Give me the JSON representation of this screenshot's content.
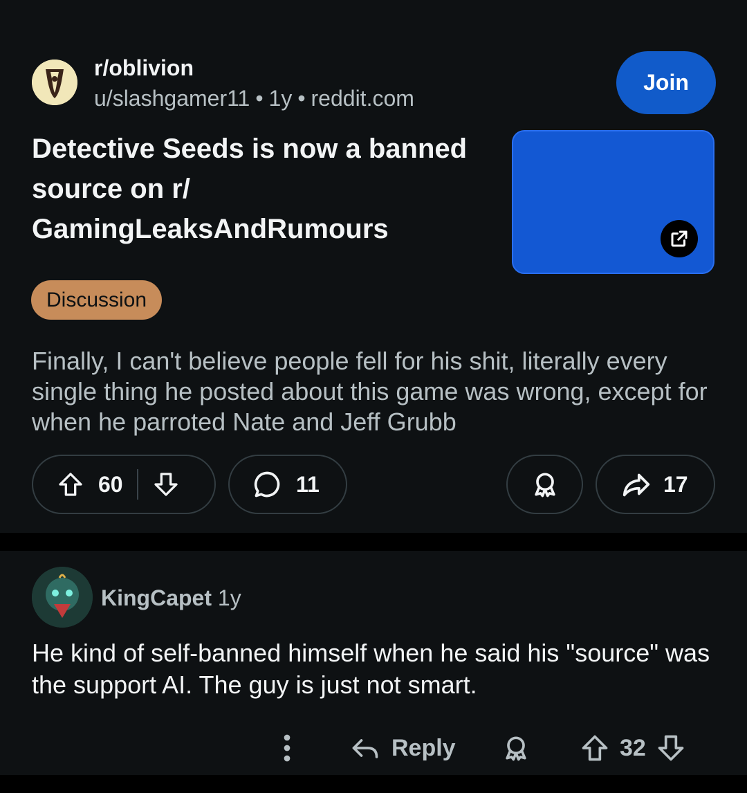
{
  "post": {
    "subreddit": "r/oblivion",
    "author": "u/slashgamer11",
    "age": "1y",
    "domain": "reddit.com",
    "separator": "•",
    "join_label": "Join",
    "title": "Detective Seeds is now a banned source on r/ GamingLeaksAndRumours",
    "flair": "Discussion",
    "flair_color": "#c78c5a",
    "body": "Finally, I can't believe people fell for his shit, literally every single thing he posted about this game was wrong, except for when he parroted Nate and Jeff Grubb",
    "score": "60",
    "comments": "11",
    "shares": "17",
    "thumbnail_color": "#1358d3"
  },
  "comment": {
    "author": "KingCapet",
    "age": "1y",
    "text": "He kind of self-banned himself when he said his \"source\" was the support AI. The guy is just not smart.",
    "reply_label": "Reply",
    "score": "32"
  },
  "colors": {
    "background": "#0e1113",
    "accent": "#115bca",
    "text_primary": "#f2f4f5",
    "text_secondary": "#b7c0c4"
  },
  "icons": [
    "subreddit-avatar",
    "external-link-icon",
    "upvote-icon",
    "downvote-icon",
    "comment-icon",
    "award-icon",
    "share-icon",
    "more-options-icon",
    "reply-icon"
  ]
}
